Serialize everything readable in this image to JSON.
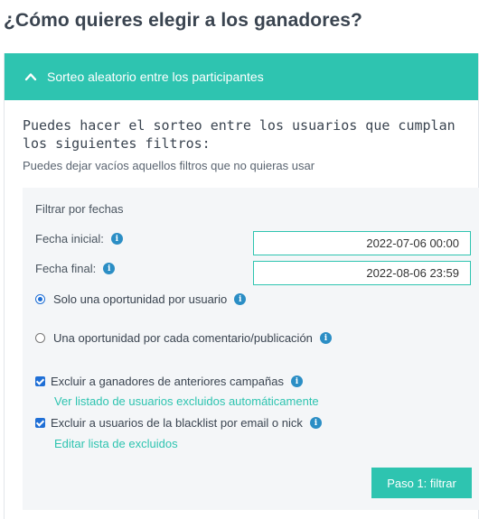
{
  "page": {
    "title": "¿Cómo quieres elegir a los ganadores?"
  },
  "panel": {
    "header_label": "Sorteo aleatorio entre los participantes",
    "intro_text": "Puedes hacer el sorteo entre los usuarios que cumplan los siguientes filtros:",
    "hint_text": "Puedes dejar vacíos aquellos filtros que no quieras usar"
  },
  "filters": {
    "title": "Filtrar por fechas",
    "start_label": "Fecha inicial:",
    "start_value": "2022-07-06 00:00",
    "end_label": "Fecha final:",
    "end_value": "2022-08-06 23:59",
    "radio_one_label": "Solo una oportunidad por usuario",
    "radio_one_selected": true,
    "radio_two_label": "Una oportunidad por cada comentario/publicación",
    "radio_two_selected": false,
    "check_one_label": "Excluir a ganadores de anteriores campañas",
    "check_one_checked": true,
    "check_one_link": "Ver listado de usuarios excluidos automáticamente",
    "check_two_label": "Excluir a usuarios de la blacklist por email o nick",
    "check_two_checked": true,
    "check_two_link": "Editar lista de excluidos",
    "submit_label": "Paso 1: filtrar"
  },
  "colors": {
    "accent": "#2ec4b0",
    "info": "#2b8ec5",
    "control": "#1f6fd6"
  },
  "icons": {
    "collapse": "chevron-up-icon",
    "info": "info-icon"
  }
}
